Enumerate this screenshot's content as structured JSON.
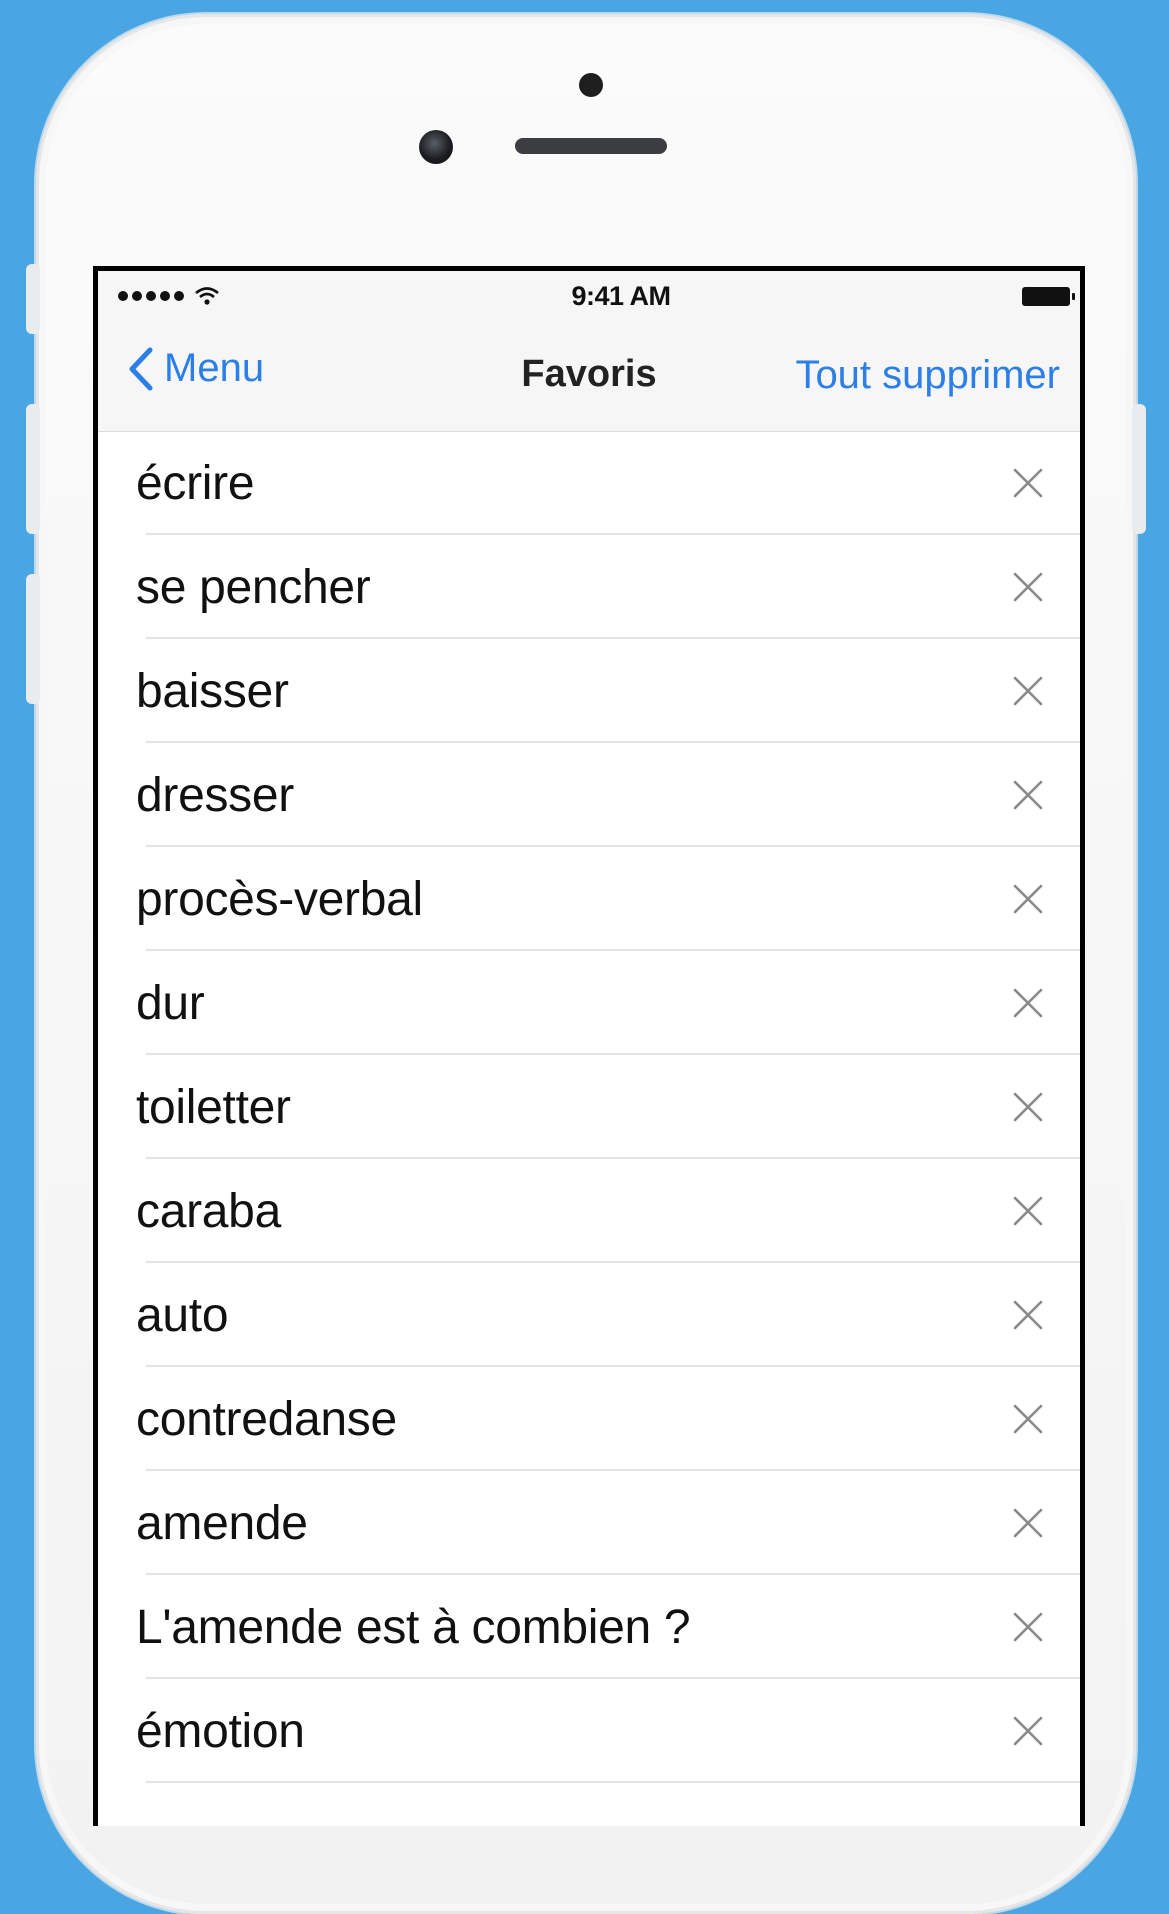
{
  "status_bar": {
    "time": "9:41 AM",
    "signal_icon": "signal-dots-icon",
    "wifi_icon": "wifi-icon",
    "battery_icon": "battery-icon"
  },
  "nav": {
    "back_label": "Menu",
    "back_icon": "chevron-left-icon",
    "title": "Favoris",
    "action_label": "Tout supprimer"
  },
  "favorites": [
    {
      "label": "écrire"
    },
    {
      "label": "se pencher"
    },
    {
      "label": "baisser"
    },
    {
      "label": "dresser"
    },
    {
      "label": "procès-verbal"
    },
    {
      "label": "dur"
    },
    {
      "label": "toiletter"
    },
    {
      "label": "caraba"
    },
    {
      "label": "auto"
    },
    {
      "label": "contredanse"
    },
    {
      "label": "amende"
    },
    {
      "label": "L'amende est à combien ?"
    },
    {
      "label": "émotion"
    }
  ],
  "colors": {
    "background": "#4aa6e3",
    "accent": "#2b7fe6",
    "navbar": "#f6f6f7"
  }
}
